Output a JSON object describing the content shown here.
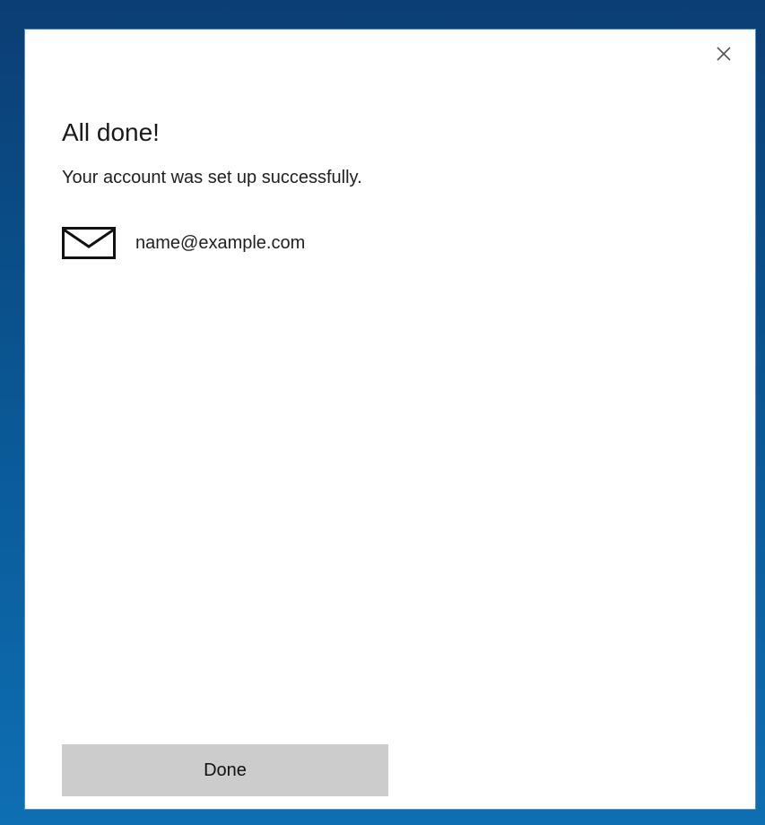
{
  "dialog": {
    "close_icon": "close-icon",
    "title": "All done!",
    "subtitle": "Your account was set up successfully.",
    "account": {
      "icon": "mail-icon",
      "email": "name@example.com"
    },
    "done_button_label": "Done"
  },
  "colors": {
    "desktop_background": "#0a5a98",
    "dialog_background": "#ffffff",
    "button_background": "#cccccc",
    "text": "#1a1a1a"
  }
}
